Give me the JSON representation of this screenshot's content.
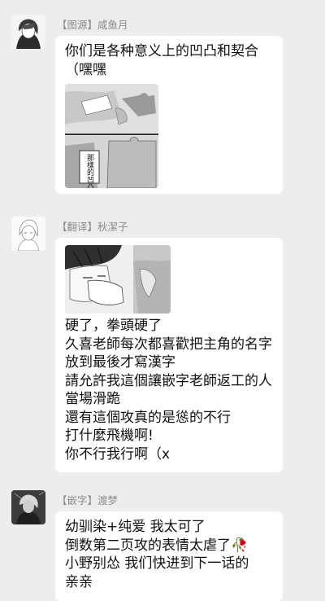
{
  "messages": [
    {
      "sender": "【图源】咸鱼月",
      "text": "你们是各种意义上的凹凸和契合（嘿嘿",
      "image_caption": "那樣的凹凸"
    },
    {
      "sender": "【翻译】秋潔子",
      "text": "硬了，拳頭硬了\n久喜老師每次都喜歡把主角的名字放到最後才寫漢字\n請允許我這個讓嵌字老師返工的人當場滑跪\n還有這個攻真的是慫的不行\n打什麼飛機啊!\n你不行我行啊（x"
    },
    {
      "sender": "【嵌字】渡梦",
      "text": "幼驯染+纯爱 我太可了\n倒数第二页攻的表情太虐了🥀\n小野别怂 我们快进到下一话的\n亲亲"
    }
  ],
  "colors": {
    "background": "#ededed",
    "bubble": "#ffffff",
    "sender_text": "#8a8a8a",
    "message_text": "#111111"
  }
}
